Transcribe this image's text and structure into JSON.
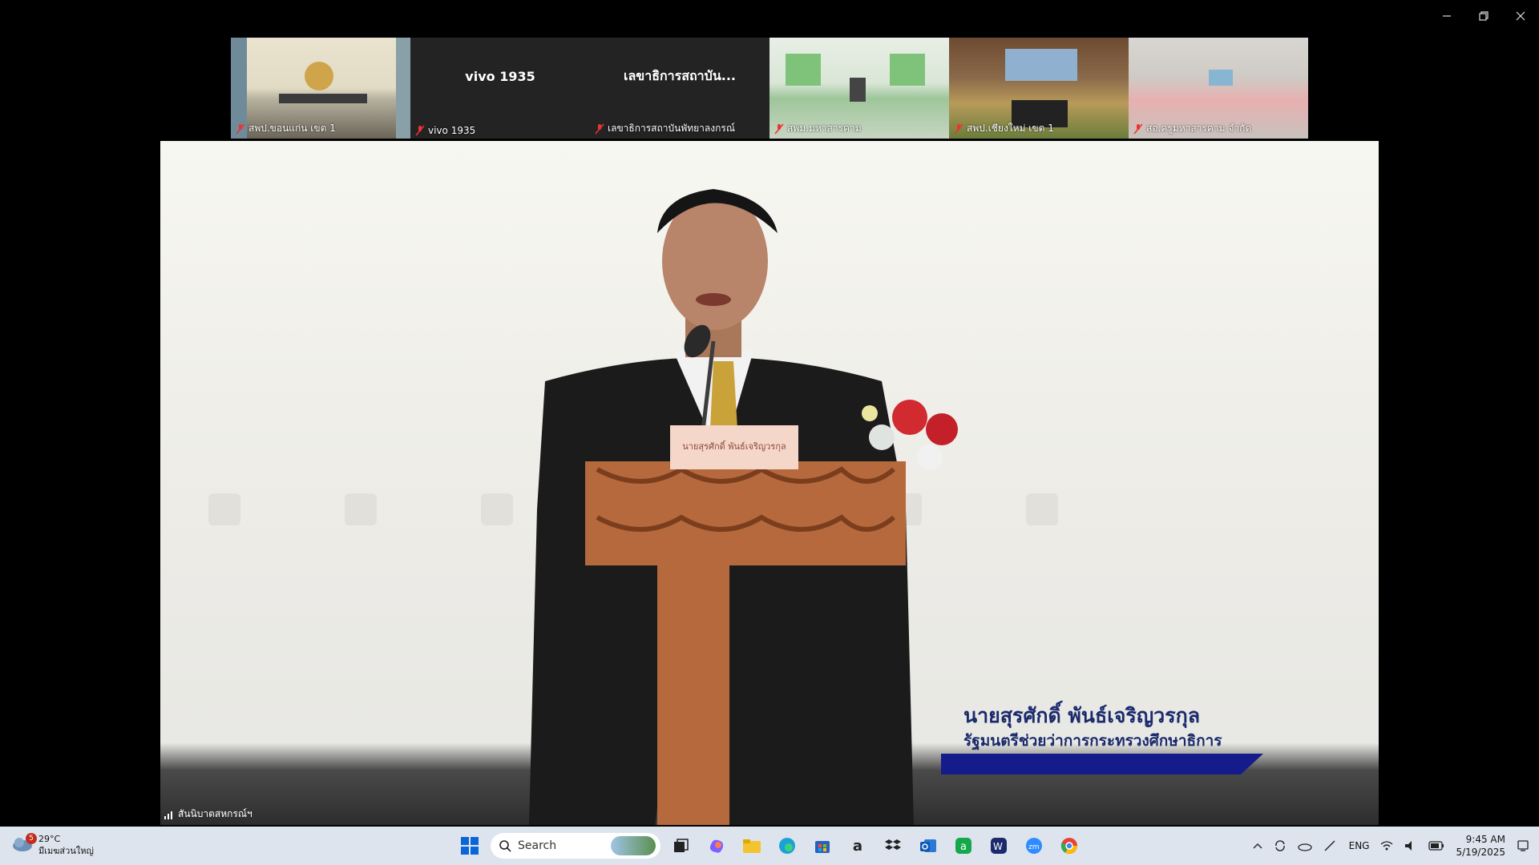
{
  "window": {
    "controls": [
      "minimize",
      "restore",
      "close"
    ]
  },
  "participants": [
    {
      "name": "สพป.ขอนแก่น เขต 1",
      "display": "video",
      "muted": true
    },
    {
      "name": "vivo 1935",
      "display": "name",
      "center_text": "vivo 1935",
      "muted": true
    },
    {
      "name": "เลขาธิการสถาบันพัทยาลงกรณ์",
      "display": "name",
      "center_text": "เลขาธิการสถาบัน...",
      "muted": true
    },
    {
      "name": "สพม.มหาสารคาม",
      "display": "video",
      "muted": true
    },
    {
      "name": "สพป.เชียงใหม่ เขต 1",
      "display": "video",
      "muted": true
    },
    {
      "name": "สอ.ครูมหาสารคาม จำกัด",
      "display": "video",
      "muted": true
    }
  ],
  "main_video": {
    "speaker_name": "นายสุรศักดิ์ พันธ์เจริญวรกุล",
    "speaker_title": "รัฐมนตรีช่วยว่าการกระทรวงศึกษาธิการ",
    "podium_sign": "นายสุรศักดิ์ พันธ์เจริญวรกุล",
    "connection_label": "สันนิบาตสหกรณ์ฯ",
    "lower_third_color": "#141c8c"
  },
  "taskbar": {
    "weather": {
      "temp": "29°C",
      "condition": "มีเมฆส่วนใหญ่",
      "badge": "5"
    },
    "search_placeholder": "Search",
    "apps": [
      "windows-start-icon",
      "task-view-icon",
      "copilot-icon",
      "file-explorer-icon",
      "edge-icon",
      "store-icon",
      "amazon-icon",
      "dropbox-icon",
      "outlook-icon",
      "line-app-icon",
      "webex-icon",
      "zoom-icon",
      "chrome-icon"
    ],
    "tray": {
      "language": "ENG",
      "time": "9:45 AM",
      "date": "5/19/2025"
    }
  }
}
